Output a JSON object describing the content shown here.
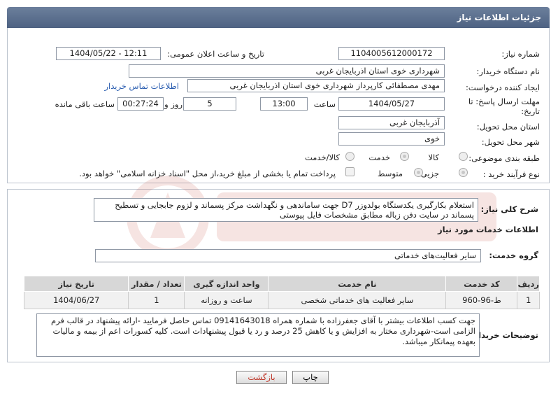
{
  "header": {
    "title": "جزئیات اطلاعات نیاز"
  },
  "fields": {
    "need_number_label": "شماره نیاز:",
    "need_number": "1104005612000172",
    "announce_label": "تاریخ و ساعت اعلان عمومی:",
    "announce_value": "1404/05/22 - 12:11",
    "buyer_label": "نام دستگاه خریدار:",
    "buyer_value": "شهرداری خوی استان اذربایجان غربی",
    "creator_label": "ایجاد کننده درخواست:",
    "creator_value": "مهدی مصطفائی کارپرداز شهرداری خوی استان اذربایجان غربی",
    "contact_link": "اطلاعات تماس خریدار",
    "deadline_label": "مهلت ارسال پاسخ: تا تاریخ:",
    "deadline_date": "1404/05/27",
    "time_label": "ساعت",
    "deadline_time": "13:00",
    "days_value": "5",
    "days_label": "روز و",
    "remaining_value": "00:27:24",
    "remaining_label": "ساعت باقی مانده",
    "province_label": "استان محل تحویل:",
    "province_value": "آذربایجان غربی",
    "city_label": "شهر محل تحویل:",
    "city_value": "خوی",
    "category_label": "طبقه بندی موضوعی:",
    "category_options": [
      "کالا",
      "خدمت",
      "کالا/خدمت"
    ],
    "process_label": "نوع فرآیند خرید :",
    "process_options": [
      "جزیی",
      "متوسط"
    ],
    "payment_note": "پرداخت تمام یا بخشی از مبلغ خرید،از محل \"اسناد خزانه اسلامی\" خواهد بود."
  },
  "summary": {
    "label": "شرح کلی نیاز:",
    "text": "استعلام بکارگیری یکدستگاه بولدوزر  D7 جهت ساماندهی و نگهداشت مرکز پسماند و لزوم جابجایی و تسطیح پسماند در سایت دفن زباله مطابق مشخصات فایل پیوستی"
  },
  "services": {
    "section_title": "اطلاعات خدمات مورد نیاز",
    "group_label": "گروه خدمت:",
    "group_value": "سایر فعالیت‌های خدماتی",
    "columns": [
      "ردیف",
      "کد خدمت",
      "نام خدمت",
      "واحد اندازه گیری",
      "تعداد / مقدار",
      "تاریخ نیاز"
    ],
    "rows": [
      {
        "row": "1",
        "code": "ط-96-960",
        "name": "سایر فعالیت های خدماتی شخصی",
        "unit": "ساعت و روزانه",
        "qty": "1",
        "date": "1404/06/27"
      }
    ]
  },
  "buyer_notes": {
    "label": "توضیحات خریدار:",
    "text": "جهت کسب اطلاعات بیشتر با آقای جعفرزاده با شماره همراه 09141643018 تماس حاصل فرمایید -ارائه پیشنهاد در قالب فرم الزامی است-شهرداری مختار به افزایش و یا کاهش 25 درصد و رد یا قبول پیشنهادات است. کلیه کسورات اعم از بیمه و مالیات بعهده پیمانکار میباشد."
  },
  "buttons": {
    "print": "چاپ",
    "back": "بازگشت"
  },
  "colors": {
    "header": "#5a6d8c",
    "link": "#2a5db0",
    "back_text": "#c0392b"
  }
}
